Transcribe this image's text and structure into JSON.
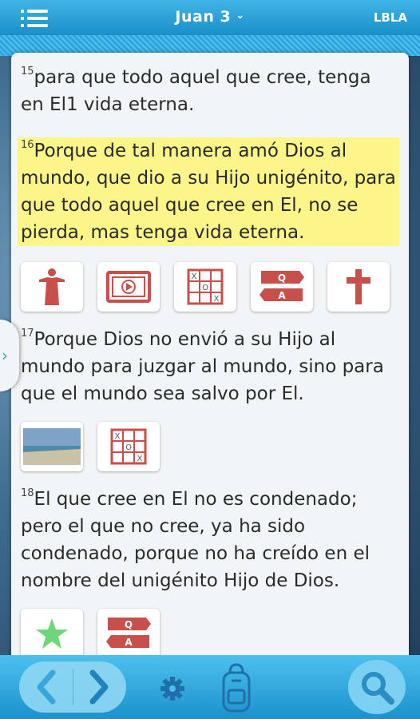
{
  "header": {
    "title": "Juan 3",
    "chevron": "⌄",
    "version": "LBLA"
  },
  "verses": [
    {
      "num": "15",
      "text": "para que todo aquel que cree, tenga en El1  vida eterna."
    },
    {
      "num": "16",
      "text": "Porque de tal manera amó Dios al mundo, que dio a su Hijo unigénito, para que todo aquel que cree en El, no se pierda, mas tenga vida eterna."
    },
    {
      "num": "17",
      "text": "Porque Dios no envió a su Hijo al mundo para juzgar al mundo, sino para que el mundo sea salvo por El."
    },
    {
      "num": "18",
      "text": "El que cree en El no es condenado; pero el que no cree, ya ha sido condenado, porque no ha creído en el nombre del unigénito Hijo de Dios."
    }
  ],
  "icon_labels": {
    "qa_q": "Q",
    "qa_a": "A",
    "x": "X",
    "o": "O"
  },
  "icons": {
    "row16": [
      "jesus-figure-icon",
      "video-icon",
      "tic-tac-toe-icon",
      "qa-icon",
      "cross-icon"
    ],
    "row17": [
      "beach-photo-thumbnail",
      "tic-tac-toe-icon"
    ],
    "row18": [
      "star-icon",
      "qa-icon"
    ]
  },
  "colors": {
    "accent": "#1a8fc9",
    "highlight": "#fbf58a",
    "icon_red": "#c8504a",
    "star_green": "#6fd67a"
  }
}
